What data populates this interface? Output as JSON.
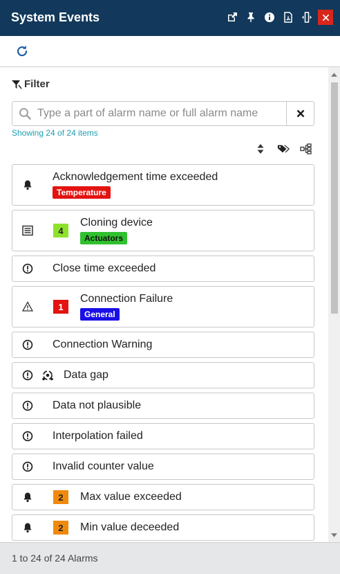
{
  "window": {
    "title": "System Events",
    "tool_icons": [
      "popout-icon",
      "pin-icon",
      "info-icon",
      "pdf-icon",
      "resize-icon",
      "close-icon"
    ]
  },
  "toolbar": {
    "refresh_icon": "refresh-icon"
  },
  "filter": {
    "label": "Filter",
    "placeholder": "Type a part of alarm name or full alarm name",
    "value": "",
    "showing": "Showing 24 of 24 items"
  },
  "sort_icons": [
    "sort-icon",
    "tag-icon",
    "hierarchy-icon"
  ],
  "alarms": [
    {
      "name": "Acknowledgement time exceeded",
      "icon": "bell-icon",
      "tag": "Temperature",
      "tag_color": "#e3130f",
      "tag_text_color": "#ffffff"
    },
    {
      "name": "Cloning device",
      "icon": "list-icon",
      "count": "4",
      "count_color": "#8fe22b",
      "count_text_color": "#222222",
      "tag": "Actuators",
      "tag_color": "#2fc12f",
      "tag_text_color": "#111111"
    },
    {
      "name": "Close time exceeded",
      "icon": "exclamation-circle-icon"
    },
    {
      "name": "Connection Failure",
      "icon": "warning-triangle-icon",
      "count": "1",
      "count_color": "#e3130f",
      "count_text_color": "#ffffff",
      "tag": "General",
      "tag_color": "#1a0fe6",
      "tag_text_color": "#ffffff"
    },
    {
      "name": "Connection Warning",
      "icon": "exclamation-circle-icon"
    },
    {
      "name": "Data gap",
      "icon": "exclamation-circle-icon",
      "sub_icon": "data-gap-icon"
    },
    {
      "name": "Data not plausible",
      "icon": "exclamation-circle-icon"
    },
    {
      "name": "Interpolation failed",
      "icon": "exclamation-circle-icon"
    },
    {
      "name": "Invalid counter value",
      "icon": "exclamation-circle-icon"
    },
    {
      "name": "Max value exceeded",
      "icon": "bell-icon",
      "count": "2",
      "count_color": "#f08a0e",
      "count_text_color": "#222222"
    },
    {
      "name": "Min value deceeded",
      "icon": "bell-icon",
      "count": "2",
      "count_color": "#f08a0e",
      "count_text_color": "#222222"
    }
  ],
  "footer": {
    "summary": "1 to 24 of 24 Alarms"
  },
  "colors": {
    "titlebar": "#12395b",
    "accent": "#1e9fb0",
    "close": "#d9261c"
  }
}
